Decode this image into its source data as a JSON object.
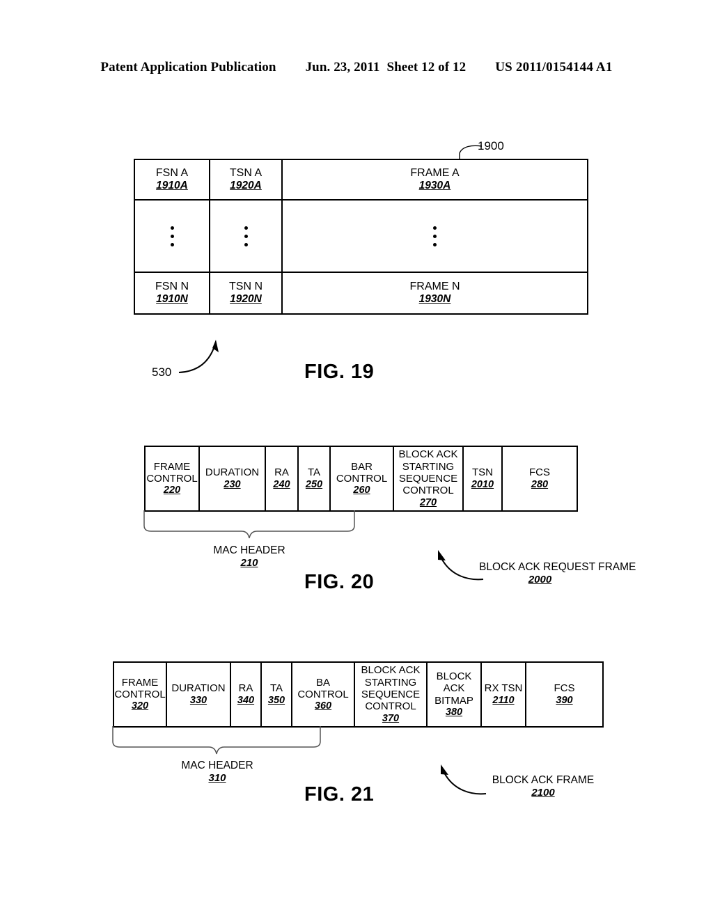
{
  "header": {
    "publication": "Patent Application Publication",
    "date": "Jun. 23, 2011",
    "sheet": "Sheet 12 of 12",
    "patent_number": "US 2011/0154144 A1"
  },
  "fig19": {
    "caption": "FIG. 19",
    "diagram_ref": "1900",
    "pointer_ref": "530",
    "columns": [
      "FSN",
      "TSN",
      "FRAME"
    ],
    "rows": [
      {
        "cells": [
          {
            "label": "FSN A",
            "ref": "1910A"
          },
          {
            "label": "TSN A",
            "ref": "1920A"
          },
          {
            "label": "FRAME A",
            "ref": "1930A"
          }
        ]
      },
      {
        "ellipsis": true,
        "cells": [
          {
            "label": "⋮",
            "ref": ""
          },
          {
            "label": "⋮",
            "ref": ""
          },
          {
            "label": "⋮",
            "ref": ""
          }
        ]
      },
      {
        "cells": [
          {
            "label": "FSN N",
            "ref": "1910N"
          },
          {
            "label": "TSN N",
            "ref": "1920N"
          },
          {
            "label": "FRAME N",
            "ref": "1930N"
          }
        ]
      }
    ]
  },
  "fig20": {
    "caption": "FIG. 20",
    "fields": [
      {
        "label": "FRAME CONTROL",
        "ref": "220"
      },
      {
        "label": "DURATION",
        "ref": "230"
      },
      {
        "label": "RA",
        "ref": "240"
      },
      {
        "label": "TA",
        "ref": "250"
      },
      {
        "label": "BAR CONTROL",
        "ref": "260"
      },
      {
        "label": "BLOCK ACK STARTING SEQUENCE CONTROL",
        "ref": "270"
      },
      {
        "label": "TSN",
        "ref": "2010"
      },
      {
        "label": "FCS",
        "ref": "280"
      }
    ],
    "brace": {
      "label": "MAC HEADER",
      "ref": "210"
    },
    "callout": {
      "label": "BLOCK ACK REQUEST FRAME",
      "ref": "2000"
    }
  },
  "fig21": {
    "caption": "FIG. 21",
    "fields": [
      {
        "label": "FRAME CONTROL",
        "ref": "320"
      },
      {
        "label": "DURATION",
        "ref": "330"
      },
      {
        "label": "RA",
        "ref": "340"
      },
      {
        "label": "TA",
        "ref": "350"
      },
      {
        "label": "BA CONTROL",
        "ref": "360"
      },
      {
        "label": "BLOCK ACK STARTING SEQUENCE CONTROL",
        "ref": "370"
      },
      {
        "label": "BLOCK ACK BITMAP",
        "ref": "380"
      },
      {
        "label": "RX TSN",
        "ref": "2110"
      },
      {
        "label": "FCS",
        "ref": "390"
      }
    ],
    "brace": {
      "label": "MAC HEADER",
      "ref": "310"
    },
    "callout": {
      "label": "BLOCK ACK FRAME",
      "ref": "2100"
    }
  }
}
